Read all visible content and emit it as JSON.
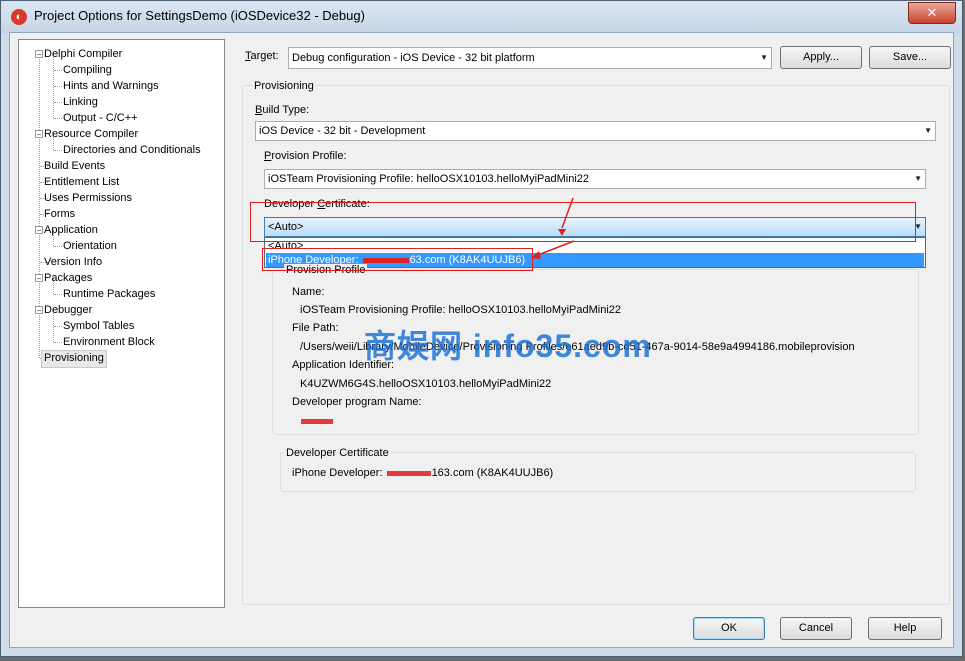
{
  "window": {
    "title": "Project Options for SettingsDemo  (iOSDevice32 - Debug)",
    "close_symbol": "✕"
  },
  "tree": {
    "items": [
      {
        "label": "Delphi Compiler"
      },
      {
        "label": "Compiling"
      },
      {
        "label": "Hints and Warnings"
      },
      {
        "label": "Linking"
      },
      {
        "label": "Output - C/C++"
      },
      {
        "label": "Resource Compiler"
      },
      {
        "label": "Directories and Conditionals"
      },
      {
        "label": "Build Events"
      },
      {
        "label": "Entitlement List"
      },
      {
        "label": "Uses Permissions"
      },
      {
        "label": "Forms"
      },
      {
        "label": "Application"
      },
      {
        "label": "Orientation"
      },
      {
        "label": "Version Info"
      },
      {
        "label": "Packages"
      },
      {
        "label": "Runtime Packages"
      },
      {
        "label": "Debugger"
      },
      {
        "label": "Symbol Tables"
      },
      {
        "label": "Environment Block"
      },
      {
        "label": "Provisioning"
      }
    ],
    "expand_symbol": "−",
    "selected": "Provisioning"
  },
  "target": {
    "label_first": "T",
    "label_rest": "arget:",
    "value": "Debug configuration - iOS Device - 32 bit platform"
  },
  "buttons": {
    "apply": "Apply...",
    "save": "Save...",
    "ok": "OK",
    "cancel": "Cancel",
    "help": "Help"
  },
  "provisioning": {
    "group_title": "Provisioning",
    "build_type_label_first": "B",
    "build_type_label_rest": "uild Type:",
    "build_type_value": "iOS Device - 32 bit - Development",
    "provision_profile_label_first": "P",
    "provision_profile_label_rest": "rovision Profile:",
    "provision_profile_value": "iOSTeam Provisioning Profile: helloOSX10103.helloMyiPadMini22",
    "developer_certificate_label_first": "Developer ",
    "developer_certificate_label_u": "C",
    "developer_certificate_label_rest": "ertificate:",
    "developer_certificate_value": "<Auto>",
    "dropdown_options": [
      "<Auto>",
      "iPhone Developer: ",
      "63.com (K8AK4UUJB6)"
    ]
  },
  "profile_details": {
    "group_title": "Provision Profile",
    "name_label": "Name:",
    "name_value": "iOSTeam Provisioning Profile: helloOSX10103.helloMyiPadMini22",
    "path_label": "File Path:",
    "path_value": "/Users/weii/Library/MobileDevice/Provisioning Profiles/e61aed9b-cd51-467a-9014-58e9a4994186.mobileprovision",
    "app_id_label": "Application Identifier:",
    "app_id_value": "K4UZWM6G4S.helloOSX10103.helloMyiPadMini22",
    "program_label": "Developer program Name:"
  },
  "cert_details": {
    "group_title": "Developer Certificate",
    "value_prefix": "iPhone Developer: ",
    "value_suffix": "163.com (K8AK4UUJB6)"
  },
  "watermark": "商娱网 info35.com",
  "colors": {
    "highlight": "#3399ff",
    "annotation": "#e02020",
    "watermark": "#1f6fd2"
  },
  "icons": [
    "app-icon",
    "close-icon",
    "dropdown-arrow-icon",
    "expand-icon"
  ]
}
